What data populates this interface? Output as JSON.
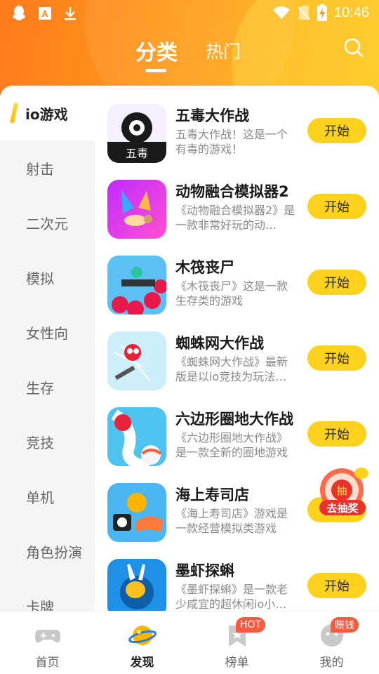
{
  "status_bar": {
    "time": "10:46",
    "left_icons": [
      "qq-icon",
      "a-box-icon",
      "download-icon"
    ],
    "right_icons": [
      "wifi-icon",
      "no-sim-icon",
      "battery-charging-icon"
    ]
  },
  "header": {
    "tabs": [
      {
        "label": "分类",
        "active": true
      },
      {
        "label": "热门",
        "active": false
      }
    ],
    "search_icon": "search-icon"
  },
  "sidebar": {
    "items": [
      {
        "label": "io游戏",
        "active": true
      },
      {
        "label": "射击"
      },
      {
        "label": "二次元"
      },
      {
        "label": "模拟"
      },
      {
        "label": "女性向"
      },
      {
        "label": "生存"
      },
      {
        "label": "竞技"
      },
      {
        "label": "单机"
      },
      {
        "label": "角色扮演"
      },
      {
        "label": "卡牌"
      }
    ]
  },
  "games": [
    {
      "title": "五毒大作战",
      "desc": "五毒大作战！这是一个有毒的游戏！",
      "button": "开始",
      "icon_text": "五毒"
    },
    {
      "title": "动物融合模拟器2",
      "desc": "《动物融合模拟器2》是一款非常好玩的动…",
      "button": "开始"
    },
    {
      "title": "木筏丧尸",
      "desc": "《木筏丧尸》这是一款生存类的游戏",
      "button": "开始"
    },
    {
      "title": "蜘蛛网大作战",
      "desc": "《蜘蛛网大作战》最新版是以io竞技为玩法…",
      "button": "开始"
    },
    {
      "title": "六边形圈地大作战",
      "desc": "《六边形圈地大作战》是一款全新的圈地游戏",
      "button": "开始"
    },
    {
      "title": "海上寿司店",
      "desc": "《海上寿司店》游戏是一款经营模拟类游戏",
      "button": "开始"
    },
    {
      "title": "墨虾探蝌",
      "desc": "《墨虾探蝌》是一款老少咸宜的超休闲io小…",
      "button": "开始"
    }
  ],
  "lottery": {
    "label": "去抽奖",
    "badge_char": "抽"
  },
  "bottom_nav": [
    {
      "label": "首页",
      "icon": "gamepad-icon",
      "active": false
    },
    {
      "label": "发现",
      "icon": "planet-icon",
      "active": true
    },
    {
      "label": "榜单",
      "icon": "bookmark-icon",
      "active": false,
      "badge": "HOT"
    },
    {
      "label": "我的",
      "icon": "profile-icon",
      "active": false,
      "badge": "赚钱"
    }
  ],
  "colors": {
    "accent": "#ffd21e",
    "header_start": "#ff7a1c",
    "header_end": "#ffc21c",
    "badge": "#ff5a3c"
  }
}
